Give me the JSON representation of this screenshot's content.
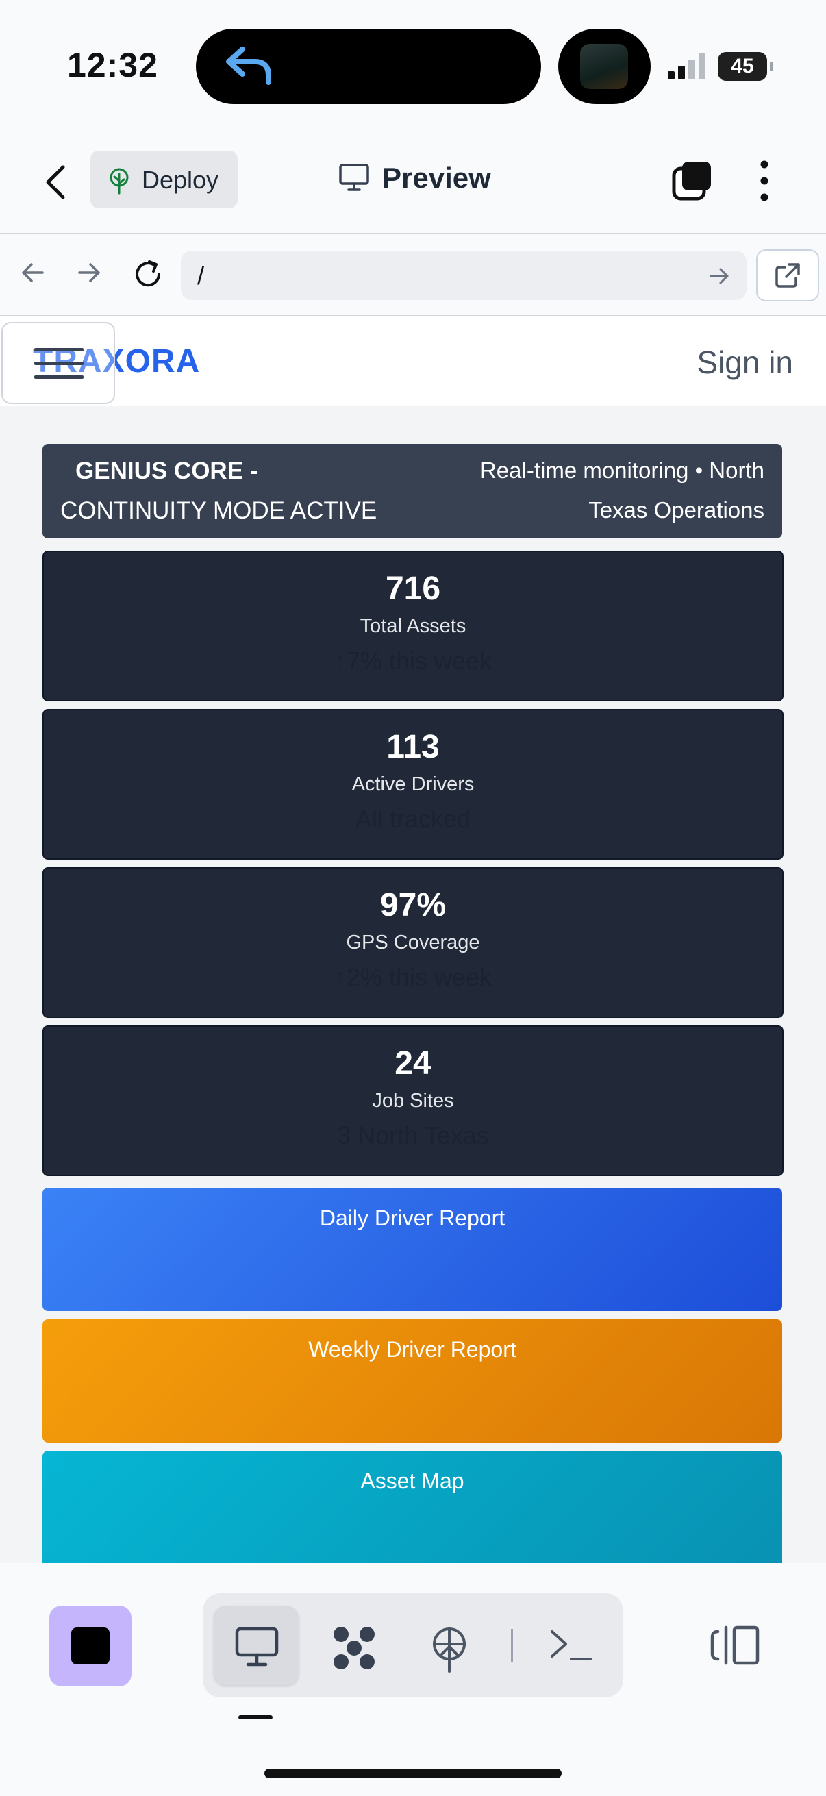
{
  "status_bar": {
    "time": "12:32",
    "battery": "45"
  },
  "toolbar": {
    "deploy_label": "Deploy",
    "preview_label": "Preview"
  },
  "browser": {
    "url": "/"
  },
  "site": {
    "brand": "TRAXORA",
    "sign_in": "Sign in"
  },
  "banner": {
    "title": "GENIUS CORE -",
    "title_cont": "CONTINUITY MODE ACTIVE",
    "subtitle_line1": "Real-time monitoring • North",
    "subtitle_line2": "Texas Operations"
  },
  "stats": [
    {
      "value": "716",
      "label": "Total Assets",
      "sub": "↑7% this week"
    },
    {
      "value": "113",
      "label": "Active Drivers",
      "sub": "All tracked"
    },
    {
      "value": "97%",
      "label": "GPS Coverage",
      "sub": "↑2% this week"
    },
    {
      "value": "24",
      "label": "Job Sites",
      "sub": "3 North Texas"
    }
  ],
  "actions": [
    {
      "label": "Daily Driver Report",
      "color_from": "#3b82f6",
      "color_to": "#1d4ed8"
    },
    {
      "label": "Weekly Driver Report",
      "color_from": "#f59e0b",
      "color_to": "#d97706"
    },
    {
      "label": "Asset Map",
      "color_from": "#06b6d4",
      "color_to": "#0891b2"
    }
  ],
  "icons": {
    "back": "chevron-left-icon",
    "deploy": "tree-icon",
    "preview": "monitor-icon",
    "tabs": "tabs-icon",
    "more": "more-vertical-icon",
    "nav_back": "arrow-left-icon",
    "nav_forward": "arrow-right-icon",
    "reload": "reload-icon",
    "go": "arrow-right-icon",
    "open_external": "external-link-icon",
    "menu": "hamburger-icon",
    "stop": "stop-icon",
    "agents": "agents-icon",
    "deploy_tab": "deploy-icon",
    "shell": "terminal-icon",
    "split": "split-view-icon"
  },
  "colors": {
    "brand": "#2563eb",
    "stop_button": "#c4b5fd",
    "card_bg": "#212938",
    "banner_bg": "#374151"
  }
}
